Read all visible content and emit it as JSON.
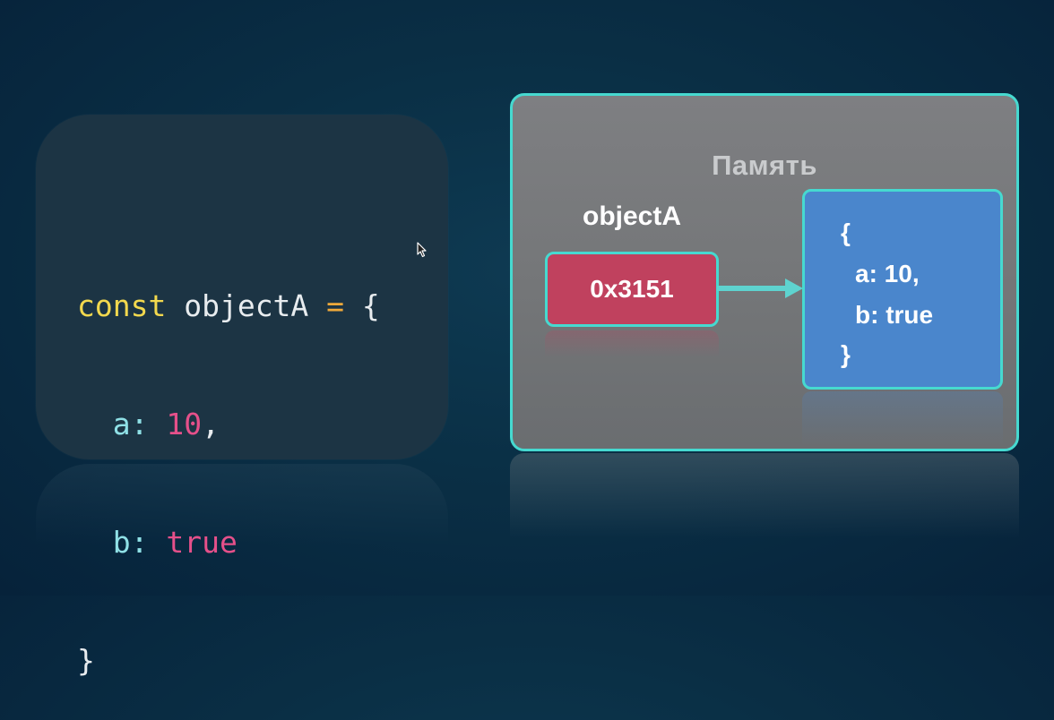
{
  "code": {
    "line1": {
      "keyword": "const",
      "name": "objectA",
      "op": "=",
      "brace": "{"
    },
    "line2": {
      "prop": "a:",
      "value": "10",
      "comma": ","
    },
    "line3": {
      "prop": "b:",
      "value": "true"
    },
    "line4": {
      "brace": "}"
    }
  },
  "memory": {
    "title": "Память",
    "variable_label": "objectA",
    "address": "0x3151",
    "object_lines": [
      "{",
      "a: 10,",
      "b: true",
      "}"
    ]
  },
  "colors": {
    "background": "#0a2f45",
    "panel_border": "#46d9d0",
    "address_fill": "#c0415e",
    "object_fill": "#4a86cc",
    "keyword": "#f2d84e",
    "number": "#e5508a"
  }
}
